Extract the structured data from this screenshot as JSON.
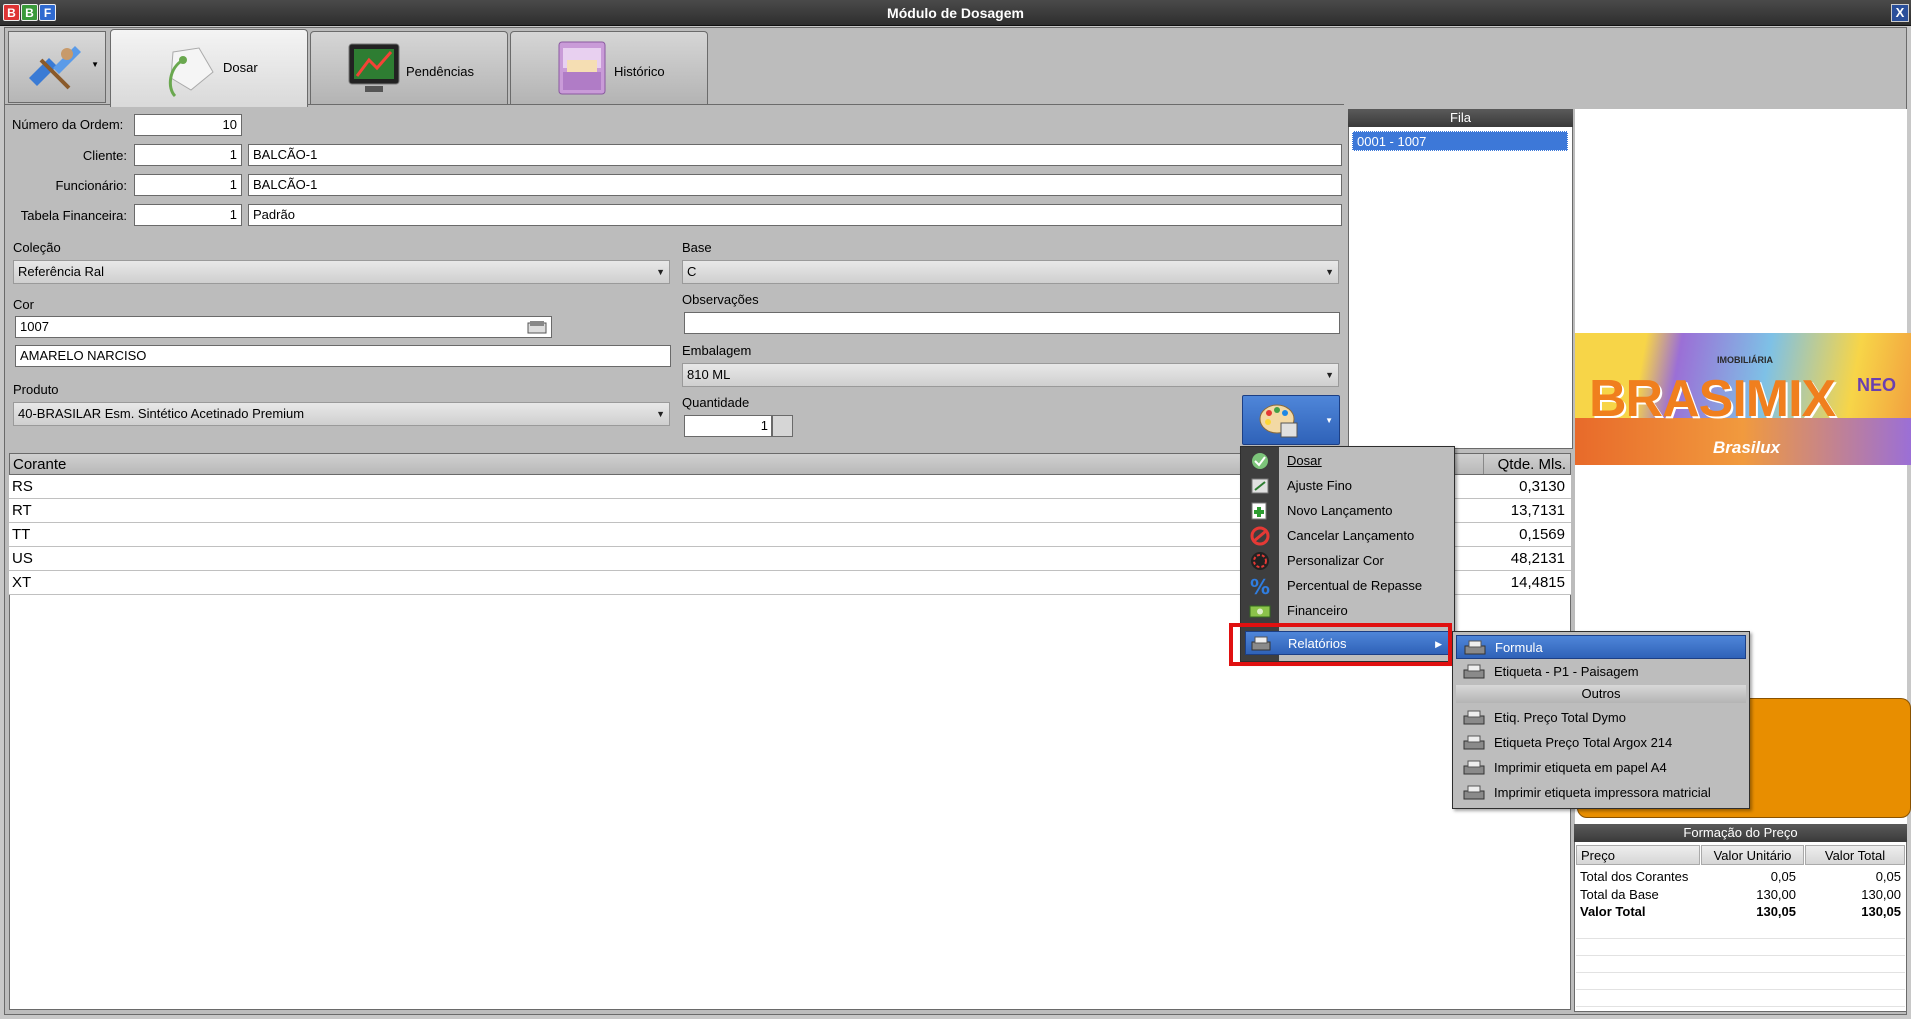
{
  "window": {
    "title": "Módulo de Dosagem",
    "logo_letters": [
      "B",
      "B",
      "F"
    ],
    "close_symbol": "X"
  },
  "tabs": [
    {
      "label": "Dosar"
    },
    {
      "label": "Pendências"
    },
    {
      "label": "Histórico"
    }
  ],
  "form": {
    "numero_ordem_label": "Número da Ordem:",
    "numero_ordem": "10",
    "cliente_label": "Cliente:",
    "cliente_code": "1",
    "cliente_name": "BALCÃO-1",
    "funcionario_label": "Funcionário:",
    "funcionario_code": "1",
    "funcionario_name": "BALCÃO-1",
    "tabela_label": "Tabela Financeira:",
    "tabela_code": "1",
    "tabela_name": "Padrão",
    "colecao_label": "Coleção",
    "colecao_value": "Referência Ral",
    "base_label": "Base",
    "base_value": "C",
    "cor_label": "Cor",
    "cor_code": "1007",
    "cor_name": "AMARELO NARCISO",
    "observacoes_label": "Observações",
    "observacoes_value": "",
    "embalagem_label": "Embalagem",
    "embalagem_value": "810 ML",
    "produto_label": "Produto",
    "produto_value": "40-BRASILAR Esm. Sintético Acetinado Premium",
    "quantidade_label": "Quantidade",
    "quantidade_value": "1"
  },
  "grid": {
    "col_corante": "Corante",
    "col_qtde": "Qtde. Mls.",
    "rows": [
      {
        "corante": "RS",
        "qtde": "0,3130"
      },
      {
        "corante": "RT",
        "qtde": "13,7131"
      },
      {
        "corante": "TT",
        "qtde": "0,1569"
      },
      {
        "corante": "US",
        "qtde": "48,2131"
      },
      {
        "corante": "XT",
        "qtde": "14,4815"
      }
    ]
  },
  "fila": {
    "title": "Fila",
    "items": [
      "0001 - 1007"
    ]
  },
  "banner": {
    "top_text": "IMOBILIÁRIA",
    "brand": "BRASIMIX",
    "suffix": "NEO",
    "bottom_text": "Brasilux"
  },
  "price": {
    "title": "Formação do Preço",
    "col_preco": "Preço",
    "col_unit": "Valor Unitário",
    "col_total": "Valor Total",
    "rows": [
      {
        "label": "Total dos Corantes",
        "unit": "0,05",
        "total": "0,05"
      },
      {
        "label": "Total da Base",
        "unit": "130,00",
        "total": "130,00"
      },
      {
        "label": "Valor Total",
        "unit": "130,05",
        "total": "130,05"
      }
    ]
  },
  "menu": {
    "items": [
      {
        "label": "Dosar",
        "icon": "dosar-icon"
      },
      {
        "label": "Ajuste Fino",
        "icon": "ajuste-fino-icon"
      },
      {
        "label": "Novo Lançamento",
        "icon": "novo-lancamento-icon"
      },
      {
        "label": "Cancelar Lançamento",
        "icon": "cancel-icon"
      },
      {
        "label": "Personalizar Cor",
        "icon": "color-wheel-icon"
      },
      {
        "label": "Percentual de Repasse",
        "icon": "percent-icon"
      },
      {
        "label": "Financeiro",
        "icon": "money-icon"
      },
      {
        "label": "Relatórios",
        "icon": "printer-icon"
      }
    ],
    "submenu": [
      {
        "label": "Formula"
      },
      {
        "label": "Etiqueta - P1 - Paisagem"
      },
      {
        "label": "Outros"
      },
      {
        "label": "Etiq. Preço Total Dymo"
      },
      {
        "label": "Etiqueta Preço Total Argox 214"
      },
      {
        "label": "Imprimir etiqueta em papel A4"
      },
      {
        "label": "Imprimir etiqueta impressora matricial"
      }
    ]
  },
  "colors": {
    "title_bar": "#3a3a3a",
    "highlight": "#3d78d8",
    "accent_orange": "#e88e00",
    "annotation_red": "#e01010"
  }
}
